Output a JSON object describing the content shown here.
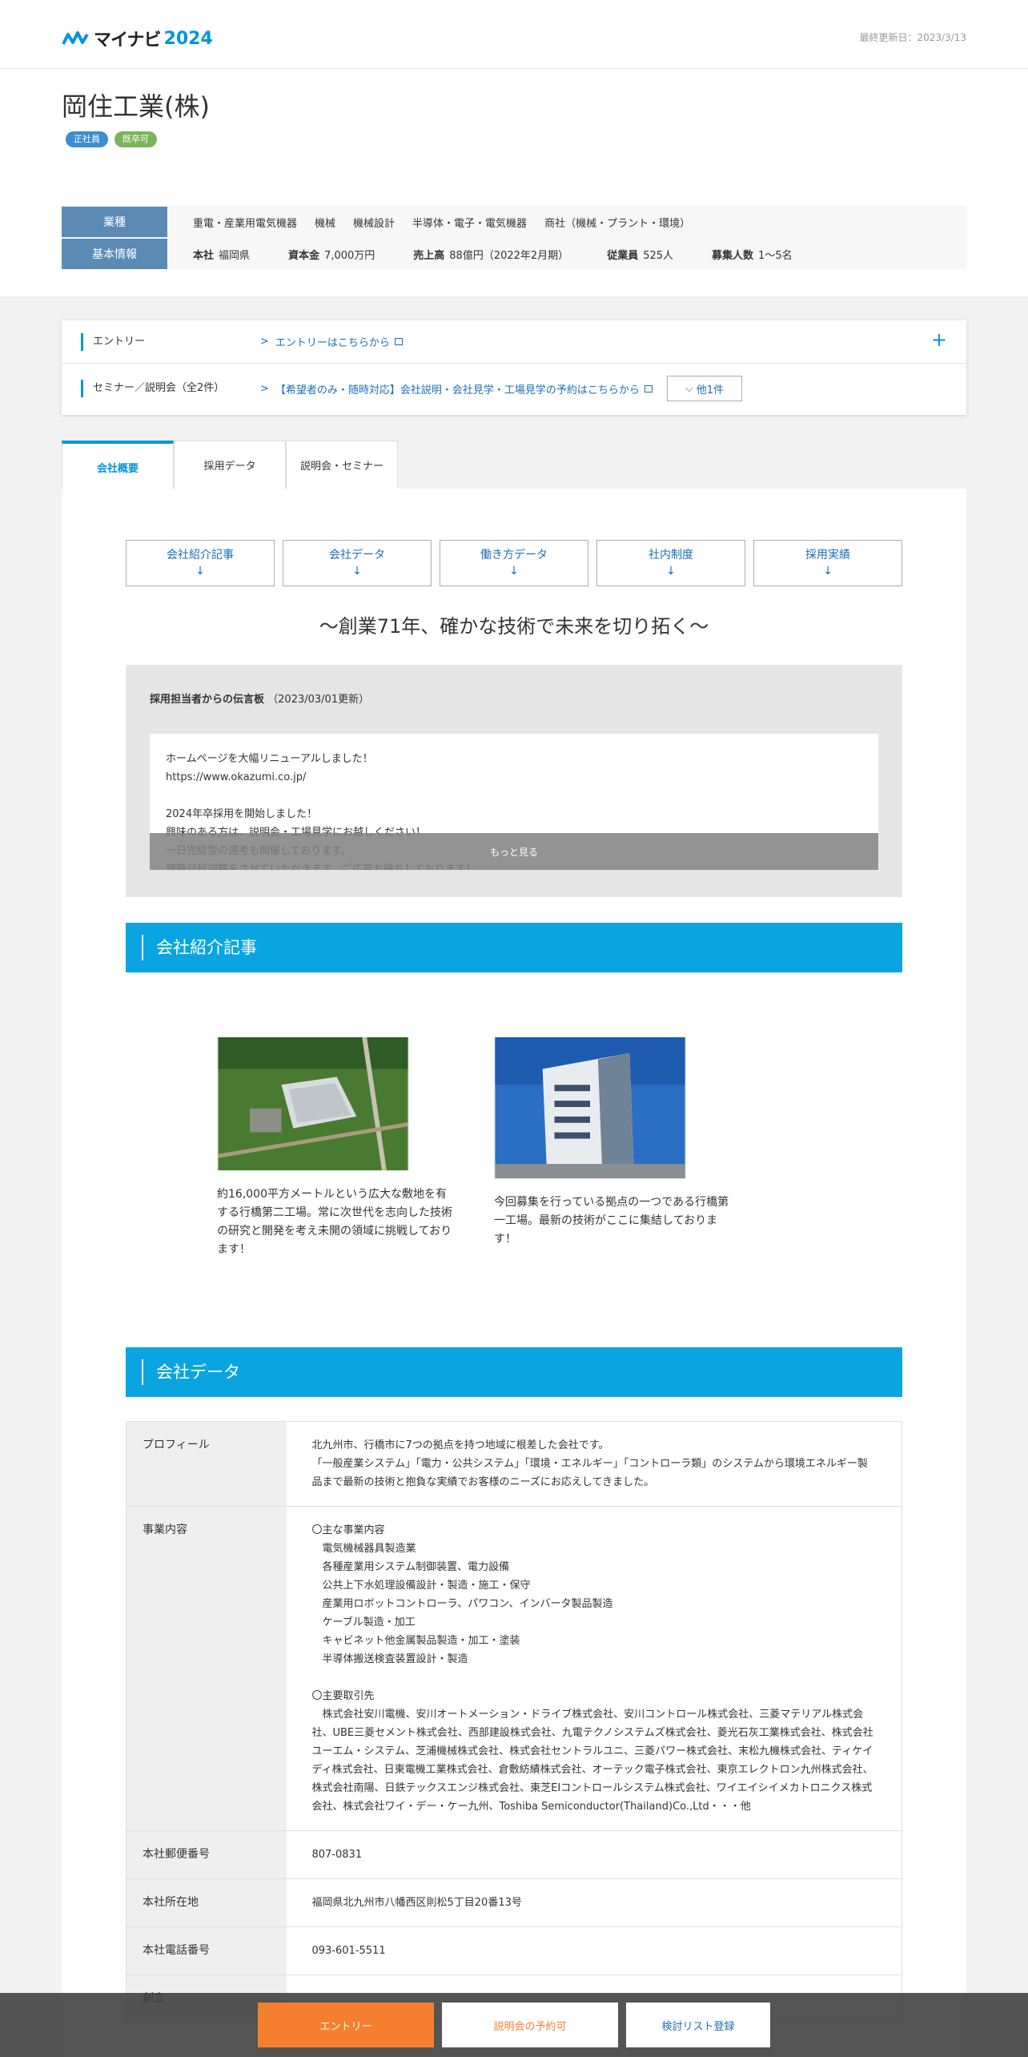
{
  "header": {
    "logo_text": "マイナビ",
    "logo_year": "2024",
    "updated": "最終更新日：2023/3/13"
  },
  "company": {
    "name": "岡住工業(株)",
    "tags": [
      "正社員",
      "既卒可"
    ]
  },
  "basic": {
    "industry_label": "業種",
    "industries": [
      "重電・産業用電気機器",
      "機械",
      "機械設計",
      "半導体・電子・電気機器",
      "商社（機械・プラント・環境）"
    ],
    "info_label": "基本情報",
    "hq_k": "本社",
    "hq_v": "福岡県",
    "capital_k": "資本金",
    "capital_v": "7,000万円",
    "sales_k": "売上高",
    "sales_v": "88億円（2022年2月期）",
    "emp_k": "従業員",
    "emp_v": "525人",
    "rec_k": "募集人数",
    "rec_v": "1～5名"
  },
  "entry": {
    "row1_label": "エントリー",
    "row1_link": "エントリーはこちらから",
    "row2_label": "セミナー／説明会（全2件）",
    "row2_link": "【希望者のみ・随時対応】会社説明・会社見学・工場見学の予約はこちらから",
    "row2_more": "他1件",
    "plus": "+"
  },
  "tabs": [
    "会社概要",
    "採用データ",
    "説明会・セミナー"
  ],
  "jumps": [
    "会社紹介記事",
    "会社データ",
    "働き方データ",
    "社内制度",
    "採用実績"
  ],
  "jump_arrow": "↓",
  "catch": "～創業71年、確かな技術で未来を切り拓く～",
  "message": {
    "title": "採用担当者からの伝言板",
    "date": "（2023/03/01更新）",
    "body": "ホームページを大幅リニューアルしました！\nhttps://www.okazumi.co.jp/\n\n2024年卒採用を開始しました！\n興味のある方は、説明会・工場見学にお越しください！\n一日完結型の選考も開催しております。\n随時日程調整をさせていただきます。ご応募お待ちしております！",
    "more": "もっと見る"
  },
  "sections": {
    "intro": "会社紹介記事",
    "data": "会社データ"
  },
  "photos": [
    {
      "caption": "約16,000平方メートルという広大な敷地を有する行橋第二工場。常に次世代を志向した技術の研究と開発を考え未開の領域に挑戦しております！"
    },
    {
      "caption": "今回募集を行っている拠点の一つである行橋第一工場。最新の技術がここに集結しております！"
    }
  ],
  "data_table": [
    {
      "k": "プロフィール",
      "v": "北九州市、行橋市に7つの拠点を持つ地域に根差した会社です。\n「一般産業システム」「電力・公共システム」「環境・エネルギー」「コントローラ類」のシステムから環境エネルギー製品まで最新の技術と抱負な実績でお客様のニーズにお応えしてきました。"
    },
    {
      "k": "事業内容",
      "v": "〇主な事業内容\n　電気機械器具製造業\n　各種産業用システム制御装置、電力設備\n　公共上下水処理設備設計・製造・施工・保守\n　産業用ロボットコントローラ、パワコン、インバータ製品製造\n　ケーブル製造・加工\n　キャビネット他金属製品製造・加工・塗装\n　半導体搬送検査装置設計・製造\n\n〇主要取引先\n　株式会社安川電機、安川オートメーション・ドライブ株式会社、安川コントロール株式会社、三菱マテリアル株式会社、UBE三菱セメント株式会社、西部建設株式会社、九電テクノシステムズ株式会社、菱光石灰工業株式会社、株式会社ユーエム・システム、芝浦機械株式会社、株式会社セントラルユニ、三菱パワー株式会社、末松九機株式会社、ティケイディ株式会社、日東電機工業株式会社、倉敷紡績株式会社、オーテック電子株式会社、東京エレクトロン九州株式会社、株式会社南陽、日鉄テックスエンジ株式会社、東芝EIコントロールシステム株式会社、ワイエイシイメカトロニクス株式会社、株式会社ワイ・デー・ケー九州、Toshiba Semiconductor(Thailand)Co.,Ltd・・・他"
    },
    {
      "k": "本社郵便番号",
      "v": "807-0831"
    },
    {
      "k": "本社所在地",
      "v": "福岡県北九州市八幡西区則松5丁目20番13号"
    },
    {
      "k": "本社電話番号",
      "v": "093-601-5511"
    },
    {
      "k": "創立",
      "v": ""
    }
  ],
  "footer": {
    "entry": "エントリー",
    "reserve": "説明会の予約可",
    "list": "検討リスト登録"
  },
  "colors": {
    "accent": "#0aa5e0",
    "brand": "#0095d9",
    "entry_button": "#f47f2f",
    "label_bg": "#5b8bb5"
  }
}
